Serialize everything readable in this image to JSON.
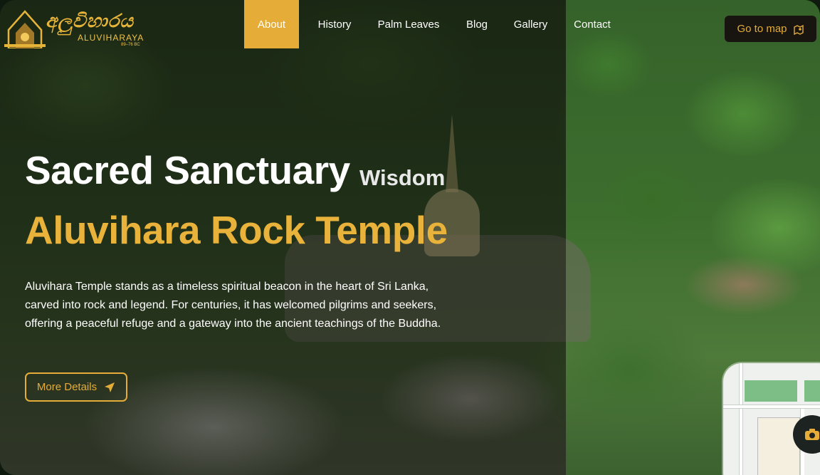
{
  "brand": {
    "script": "අලුවිහාරය",
    "name": "ALUVIHARAYA",
    "era": "89–76 BC"
  },
  "nav": {
    "items": [
      {
        "label": "About",
        "active": true
      },
      {
        "label": "History",
        "active": false
      },
      {
        "label": "Palm Leaves",
        "active": false
      },
      {
        "label": "Blog",
        "active": false
      },
      {
        "label": "Gallery",
        "active": false
      },
      {
        "label": "Contact",
        "active": false
      }
    ],
    "map_button": "Go to map",
    "map_icon": "map-pin-icon"
  },
  "hero": {
    "headline": "Sacred Sanctuary",
    "subword": "Wisdom",
    "title": "Aluvihara Rock Temple",
    "description_lines": [
      "Aluvihara Temple stands as a timeless spiritual beacon in the heart of Sri Lanka,",
      "carved into rock and legend. For centuries, it has welcomed pilgrims and seekers,",
      "offering a peaceful refuge and a gateway into the ancient teachings of the Buddha."
    ],
    "cta": "More Details",
    "cta_icon": "send-icon"
  },
  "colors": {
    "accent": "#e5ad38",
    "text": "#ffffff",
    "dark_button": "#181410"
  }
}
